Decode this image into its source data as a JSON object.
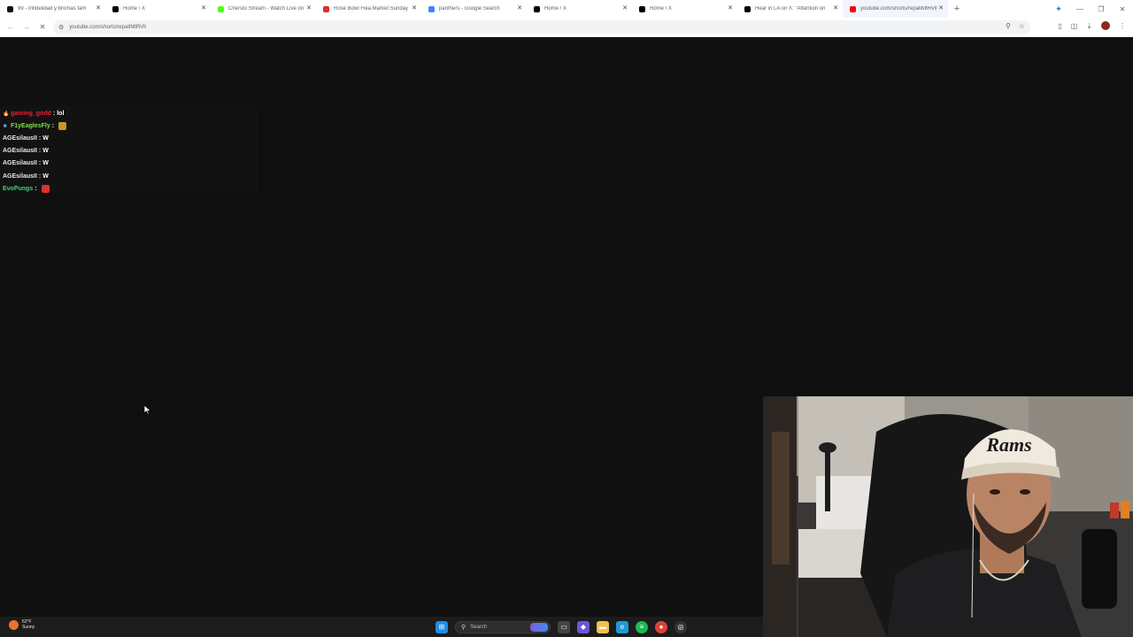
{
  "browser": {
    "tabs": [
      {
        "title": "99 - Infidelidad y bromas fam",
        "favicon": "tiktok-icon",
        "color": "#111111",
        "active": false
      },
      {
        "title": "Home / X",
        "favicon": "x-icon",
        "color": "#000000",
        "active": false
      },
      {
        "title": "Chersto Stream - Watch Live on",
        "favicon": "kick-icon",
        "color": "#53fc18",
        "active": false
      },
      {
        "title": "Rose Bowl Flea Market Sunday",
        "favicon": "pin-icon",
        "color": "#d93025",
        "active": false
      },
      {
        "title": "panthers - Google Search",
        "favicon": "google-icon",
        "color": "#4285f4",
        "active": false
      },
      {
        "title": "Home / X",
        "favicon": "x-icon",
        "color": "#000000",
        "active": false
      },
      {
        "title": "Home / X",
        "favicon": "x-icon",
        "color": "#000000",
        "active": false
      },
      {
        "title": "Hear in LA on X: \"Attention on",
        "favicon": "x-icon",
        "color": "#000000",
        "active": false
      },
      {
        "title": "youtube.com/shorts/repatiMtRVll",
        "favicon": "youtube-icon",
        "color": "#ff0000",
        "active": true
      }
    ],
    "new_tab": "+",
    "url": "youtube.com/shorts/repatiMtRVll"
  },
  "chat": {
    "messages": [
      {
        "badge": "flame-badge-icon",
        "user": "gaming_godd",
        "text": "lol",
        "user_color": "#e0243a",
        "emote": ""
      },
      {
        "badge": "sub-badge-icon",
        "user": "F1yEaglesFly",
        "text": "",
        "user_color": "#7be14a",
        "emote": "trophy-emote",
        "emote_color": "#c9962a"
      },
      {
        "badge": "",
        "user": "AGEsilausII",
        "text": "W",
        "user_color": "#e8e8e8",
        "emote": ""
      },
      {
        "badge": "",
        "user": "AGEsilausII",
        "text": "W",
        "user_color": "#e8e8e8",
        "emote": ""
      },
      {
        "badge": "",
        "user": "AGEsilausII",
        "text": "W",
        "user_color": "#e8e8e8",
        "emote": ""
      },
      {
        "badge": "",
        "user": "AGEsilausII",
        "text": "W",
        "user_color": "#e8e8e8",
        "emote": ""
      },
      {
        "badge": "",
        "user": "EvoPungs",
        "text": "",
        "user_color": "#3fcf7a",
        "emote": "red-emote",
        "emote_color": "#d8332b"
      }
    ]
  },
  "webcam": {
    "cap_text": "Rams"
  },
  "taskbar": {
    "weather_temp": "62°F",
    "weather_desc": "Sunny",
    "search_placeholder": "Search"
  }
}
